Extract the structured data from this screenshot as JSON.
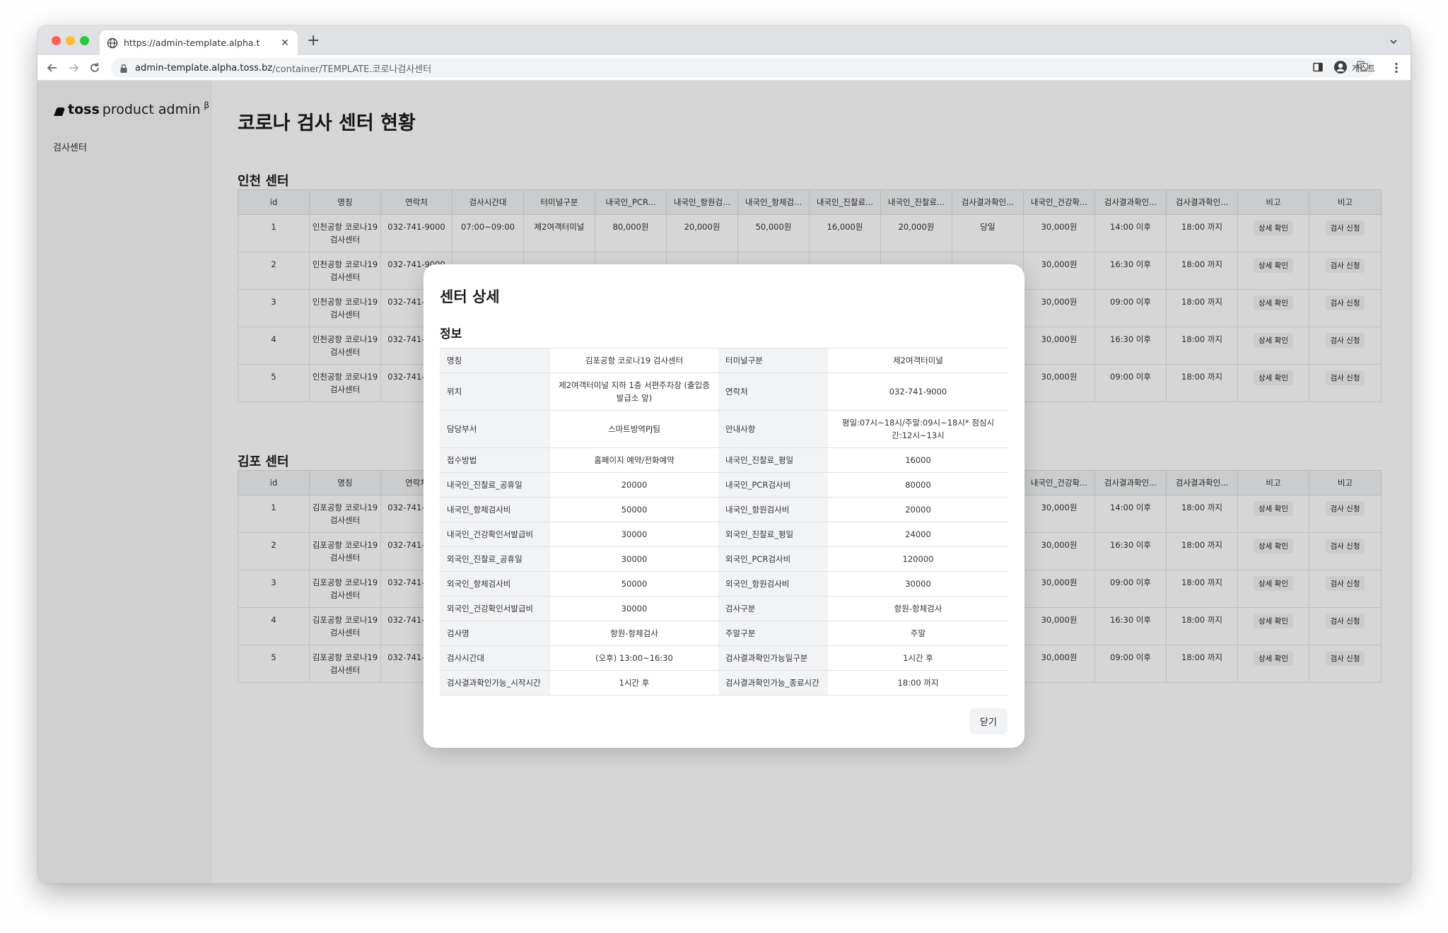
{
  "browser": {
    "tab_title": "https://admin-template.alpha.t",
    "url_host": "admin-template.alpha.toss.bz",
    "url_path": "/container/TEMPLATE.코로나검사센터",
    "profile": "게스트"
  },
  "sidebar": {
    "logo_bold": "toss",
    "logo_rest": "product admin",
    "logo_beta": "β",
    "items": [
      {
        "label": "검사센터"
      }
    ]
  },
  "main": {
    "title": "코로나 검사 센터 현황",
    "columns": [
      "id",
      "명칭",
      "연락처",
      "검사시간대",
      "터미널구분",
      "내국인_PCR...",
      "내국인_항원검...",
      "내국인_항체검...",
      "내국인_진찰료...",
      "내국인_진찰료...",
      "검사결과확인...",
      "내국인_건강확...",
      "검사결과확인...",
      "검사결과확인...",
      "비고",
      "비고"
    ],
    "detail_label": "상세 확인",
    "apply_label": "검사 신청",
    "sections": [
      {
        "title": "인천 센터",
        "rows": [
          {
            "id": "1",
            "name": "인천공항 코로나19 검사센터",
            "phone": "032-741-9000",
            "time": "07:00~09:00",
            "terminal": "제2여객터미널",
            "pcr": "80,000원",
            "antigen": "20,000원",
            "antibody": "50,000원",
            "exam_wd": "16,000원",
            "exam_hol": "20,000원",
            "result": "당일",
            "health": "30,000원",
            "result_start": "14:00 이후",
            "result_end": "18:00 까지"
          },
          {
            "id": "2",
            "name": "인천공항 코로나19 검사센터",
            "phone": "032-741-9000",
            "health": "30,000원",
            "result_start": "16:30 이후",
            "result_end": "18:00 까지"
          },
          {
            "id": "3",
            "name": "인천공항 코로나19 검사센터",
            "phone": "032-741-9000",
            "health": "30,000원",
            "result_start": "09:00 이후",
            "result_end": "18:00 까지"
          },
          {
            "id": "4",
            "name": "인천공항 코로나19 검사센터",
            "phone": "032-741-9000",
            "health": "30,000원",
            "result_start": "16:30 이후",
            "result_end": "18:00 까지"
          },
          {
            "id": "5",
            "name": "인천공항 코로나19 검사센터",
            "phone": "032-741-9000",
            "health": "30,000원",
            "result_start": "09:00 이후",
            "result_end": "18:00 까지"
          }
        ]
      },
      {
        "title": "김포 센터",
        "rows": [
          {
            "id": "1",
            "name": "김포공항 코로나19 검사센터",
            "phone": "032-741-9000",
            "health": "30,000원",
            "result_start": "14:00 이후",
            "result_end": "18:00 까지"
          },
          {
            "id": "2",
            "name": "김포공항 코로나19 검사센터",
            "phone": "032-741-9000",
            "health": "30,000원",
            "result_start": "16:30 이후",
            "result_end": "18:00 까지"
          },
          {
            "id": "3",
            "name": "김포공항 코로나19 검사센터",
            "phone": "032-741-9000",
            "health": "30,000원",
            "result_start": "09:00 이후",
            "result_end": "18:00 까지"
          },
          {
            "id": "4",
            "name": "김포공항 코로나19 검사센터",
            "phone": "032-741-9000",
            "health": "30,000원",
            "result_start": "16:30 이후",
            "result_end": "18:00 까지"
          },
          {
            "id": "5",
            "name": "김포공항 코로나19 검사센터",
            "phone": "032-741-9000",
            "health": "30,000원",
            "result_start": "09:00 이후",
            "result_end": "18:00 까지"
          }
        ]
      }
    ]
  },
  "modal": {
    "title": "센터 상세",
    "subtitle": "정보",
    "close_label": "닫기",
    "rows": [
      {
        "k1": "명칭",
        "v1": "김포공항 코로나19 검사센터",
        "k2": "터미널구분",
        "v2": "제2여객터미널"
      },
      {
        "k1": "위치",
        "v1": "제2여객터미널 지하 1층 서편주차장 (출입증발급소 앞)",
        "k2": "연락처",
        "v2": "032-741-9000"
      },
      {
        "k1": "담당부서",
        "v1": "스마트방역PJ팀",
        "k2": "안내사항",
        "v2": "평일:07시~18시/주말:09시~18시* 점심시간:12시~13시"
      },
      {
        "k1": "접수방법",
        "v1": "홈페이지 예약/전화예약",
        "k2": "내국인_진찰료_평일",
        "v2": "16000"
      },
      {
        "k1": "내국인_진찰료_공휴일",
        "v1": "20000",
        "k2": "내국인_PCR검사비",
        "v2": "80000"
      },
      {
        "k1": "내국인_항체검사비",
        "v1": "50000",
        "k2": "내국인_항원검사비",
        "v2": "20000"
      },
      {
        "k1": "내국인_건강확인서발급비",
        "v1": "30000",
        "k2": "외국인_진찰료_평일",
        "v2": "24000"
      },
      {
        "k1": "외국인_진찰료_공휴일",
        "v1": "30000",
        "k2": "외국인_PCR검사비",
        "v2": "120000"
      },
      {
        "k1": "외국인_항체검사비",
        "v1": "50000",
        "k2": "외국인_항원검사비",
        "v2": "30000"
      },
      {
        "k1": "외국인_건강확인서발급비",
        "v1": "30000",
        "k2": "검사구분",
        "v2": "항원-항체검사"
      },
      {
        "k1": "검사명",
        "v1": "항원-항체검사",
        "k2": "주말구분",
        "v2": "주말"
      },
      {
        "k1": "검사시간대",
        "v1": "(오후) 13:00~16:30",
        "k2": "검사결과확인가능일구분",
        "v2": "1시간 후"
      },
      {
        "k1": "검사결과확인가능_시작시간",
        "v1": "1시간 후",
        "k2": "검사결과확인가능_종료시간",
        "v2": "18:00 까지"
      }
    ]
  }
}
